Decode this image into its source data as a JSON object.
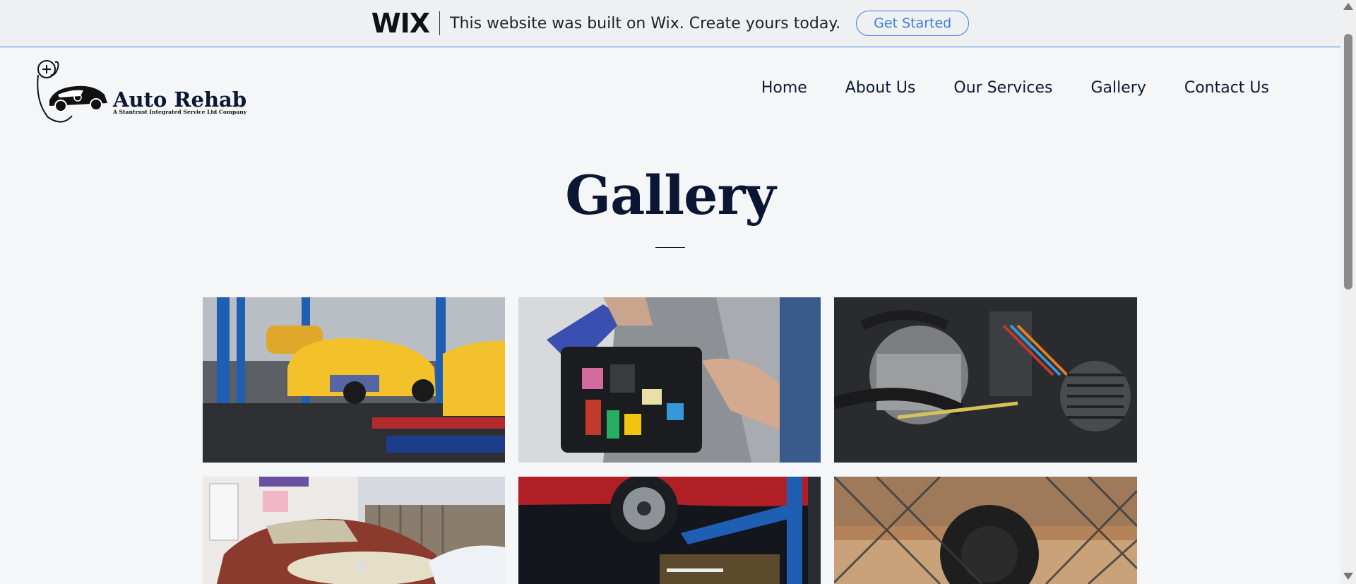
{
  "wix_banner": {
    "logo": "WIX",
    "message": "This website was built on Wix. Create yours today.",
    "cta_label": "Get Started"
  },
  "logo": {
    "name": "Auto Rehab",
    "tagline": "A Stantrust Integrated Service Ltd Company"
  },
  "nav": {
    "items": [
      "Home",
      "About Us",
      "Our Services",
      "Gallery",
      "Contact Us"
    ]
  },
  "page": {
    "title": "Gallery"
  },
  "gallery": {
    "images": [
      "taxi-repair-garage",
      "car-fuse-box-electrical",
      "engine-wiring-closeup",
      "rusty-vintage-car",
      "red-car-on-lift",
      "offroad-tire-fence"
    ]
  },
  "colors": {
    "accent": "#3b7fe0",
    "title": "#0b1634",
    "background": "#f5f6f7"
  }
}
